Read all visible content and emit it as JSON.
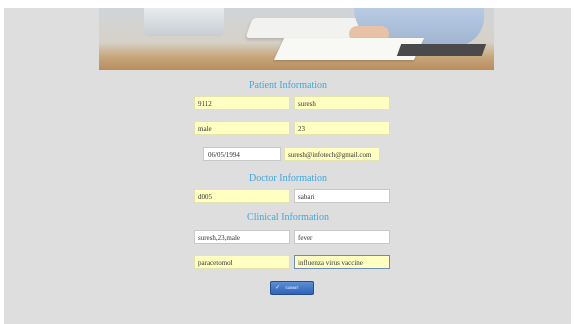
{
  "patient_section": {
    "title": "Patient Information",
    "patient_id": "9112",
    "patient_name": "suresh",
    "gender": "male",
    "age": "23",
    "dob": "06/05/1994",
    "email": "suresh@infotech@gmail.com"
  },
  "doctor_section": {
    "title": "Doctor Information",
    "doctor_id": "d005",
    "doctor_name": "sabari"
  },
  "clinical_section": {
    "title": "Clinical Information",
    "patient_summary": "suresh,23,male",
    "symptom": "fever",
    "medicine": "paracetomol",
    "vaccine": "influenza virus vaccine"
  },
  "submit_label": "SUBMIT",
  "icons": {
    "submit": "check-icon"
  },
  "colors": {
    "section_title": "#3fa7dc",
    "field_yellow": "#ffffc2",
    "button_blue": "#2d63b6"
  }
}
